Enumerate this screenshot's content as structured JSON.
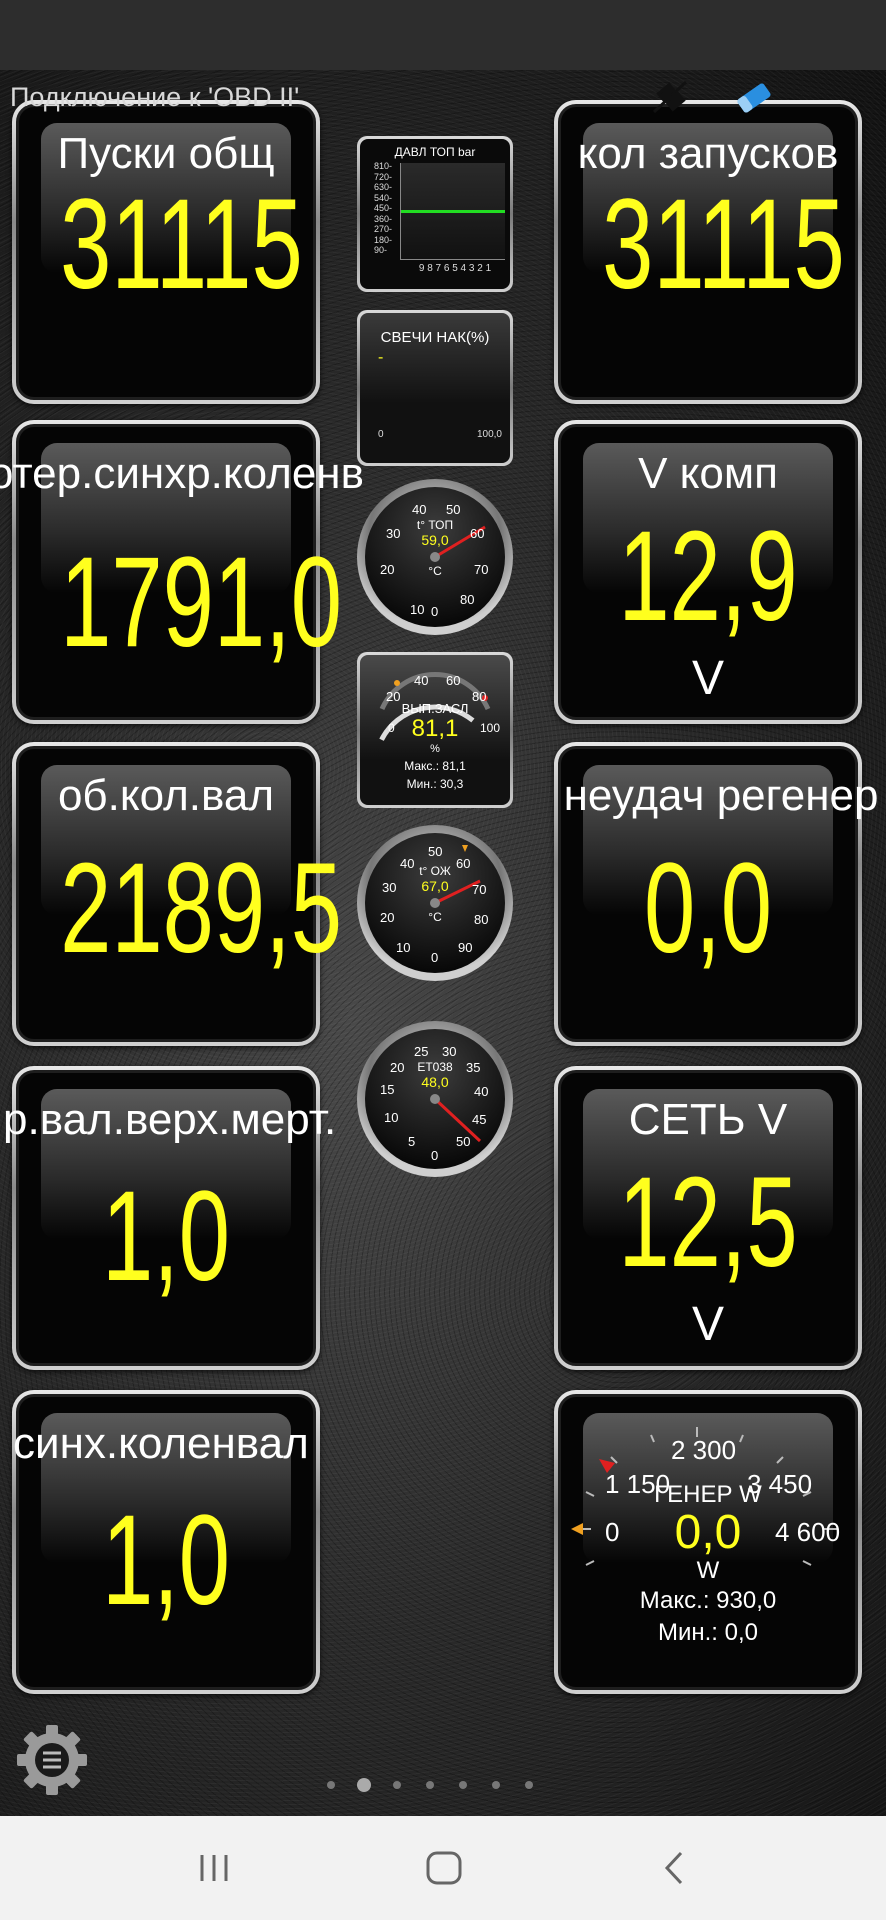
{
  "header": {
    "connection_status": "Подключение к 'OBD II'"
  },
  "left_tiles": [
    {
      "label": "Пуски общ",
      "value": "31115",
      "unit": ""
    },
    {
      "label": "отер.синхр.коленв",
      "value": "1791,0",
      "unit": ""
    },
    {
      "label": "об.кол.вал",
      "value": "2189,5",
      "unit": ""
    },
    {
      "label": "р.вал.верх.мерт.",
      "value": "1,0",
      "unit": ""
    },
    {
      "label": "синх.коленвал",
      "value": "1,0",
      "unit": ""
    }
  ],
  "right_tiles": [
    {
      "label": "кол запусков",
      "value": "31115",
      "unit": ""
    },
    {
      "label": "V комп",
      "value": "12,9",
      "unit": "V"
    },
    {
      "label": "неудач регенер",
      "value": "0,0",
      "unit": ""
    },
    {
      "label": "СЕТЬ V",
      "value": "12,5",
      "unit": "V"
    }
  ],
  "generator_gauge": {
    "ticks": [
      "2 300",
      "1 150",
      "3 450",
      "0",
      "4 600"
    ],
    "title": "ГЕНЕР W",
    "value": "0,0",
    "unit": "W",
    "max": "Макс.: 930,0",
    "min": "Мин.: 0,0"
  },
  "fuel_pressure": {
    "title": "ДАВЛ ТОП  bar",
    "y_ticks": [
      "810-",
      "720-",
      "630-",
      "540-",
      "450-",
      "360-",
      "270-",
      "180-",
      "90-"
    ],
    "x_ticks": "9 8 7 6 5 4 3 2 1",
    "line_level_fraction": 0.5,
    "line_color": "#22dd22"
  },
  "spark_plugs": {
    "title": "СВЕЧИ НАК(%)",
    "value": "-",
    "min_label": "0",
    "max_label": "100,0"
  },
  "fuel_temp_gauge": {
    "ticks": [
      "10",
      "20",
      "30",
      "40",
      "50",
      "60",
      "70",
      "80",
      "0"
    ],
    "label": "t° ТОП",
    "value": "59,0",
    "unit": "°C"
  },
  "throttle": {
    "ticks": [
      "20",
      "40",
      "60",
      "80",
      "0",
      "100"
    ],
    "title": "ВЫП.ЗАСЛ",
    "value": "81,1",
    "unit": "%",
    "max": "Макс.: 81,1",
    "min": "Мин.: 30,3",
    "level_fraction": 0.811
  },
  "coolant_gauge": {
    "ticks": [
      "10",
      "20",
      "30",
      "40",
      "50",
      "60",
      "70",
      "80",
      "90",
      "0"
    ],
    "label": "t° ОЖ",
    "value": "67,0",
    "unit": "°C"
  },
  "et038_gauge": {
    "ticks": [
      "5",
      "10",
      "15",
      "20",
      "25",
      "30",
      "35",
      "40",
      "45",
      "50",
      "0"
    ],
    "label": "ET038",
    "value": "48,0"
  },
  "colors": {
    "value_yellow": "#ffff1e",
    "needle_red": "#e02020"
  },
  "pager": {
    "count": 7,
    "active_index": 1
  }
}
